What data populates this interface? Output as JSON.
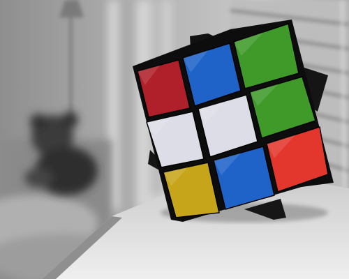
{
  "scene": {
    "subject": "rubiks-cube",
    "style": "selective-color",
    "sticker_colors": {
      "red": "#b0202a",
      "blue": "#1f63c9",
      "green": "#3f9a2a",
      "white": "#dcdde6",
      "yellow": "#c7a51a",
      "orange_red": "#e3372d",
      "cube_body": "#101010"
    },
    "face_grid": [
      [
        "red",
        "blue",
        "green"
      ],
      [
        "white",
        "white",
        "green"
      ],
      [
        "yellow",
        "blue",
        "orange_red"
      ]
    ]
  }
}
